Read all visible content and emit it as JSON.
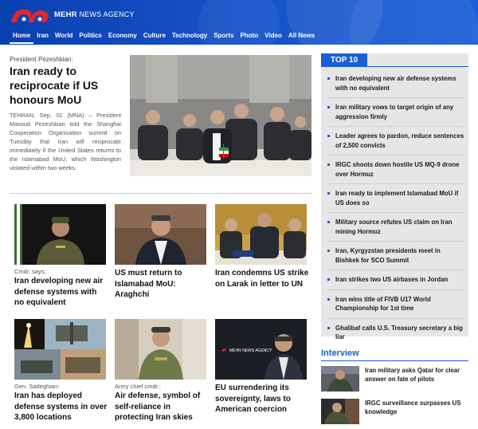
{
  "site": {
    "brand_bold": "MEHR",
    "brand_rest": " NEWS AGENCY"
  },
  "nav": [
    "Home",
    "Iran",
    "World",
    "Politics",
    "Economy",
    "Culture",
    "Technology",
    "Sports",
    "Photo",
    "Video",
    "All News"
  ],
  "lead": {
    "kicker": "President Pezeshkian:",
    "title": "Iran ready to reciprocate if US honours MoU",
    "body": "TEHRAN, Sep. 01 (MNA) – President Masoud Pezeshkian told the Shanghai Cooperation Organisation summit on Tuesday that Iran will reciprocate immediately if the United States returns to the Islamabad MoU, which Washington violated within two weeks."
  },
  "cards": [
    {
      "kicker": "Cmdr. says;",
      "title": "Iran developing new air defense systems with no equivalent"
    },
    {
      "kicker": "",
      "title": "US must return to Islamabad MoU: Araghchi"
    },
    {
      "kicker": "",
      "title": "Iran condemns US strike on Larak in letter to UN"
    },
    {
      "kicker": "Gen. Sadeghian:",
      "title": "Iran has deployed defense systems in over 3,800 locations"
    },
    {
      "kicker": "Army chief cmdr.:",
      "title": "Air defense, symbol of self-reliance in protecting Iran skies"
    },
    {
      "kicker": "",
      "title": "EU surrendering its sovereignty, laws to American coercion"
    }
  ],
  "top10": {
    "heading": "TOP 10",
    "items": [
      "Iran developing new air defense systems with no equivalent",
      "Iran military vows to target origin of any aggression firmly",
      "Leader agrees to pardon, reduce sentences of 2,500 convicts",
      "IRGC shoots down hostile US MQ-9 drone over Hormuz",
      "Iran ready to implement Islamabad MoU if US does so",
      "Military source refutes US claim on Iran mining Hormuz",
      "Iran, Kyrgyzstan presidents meet in Bishkek for SCO Summit",
      "Iran strikes two US airbases in Jordan",
      "Iran wins title of FIVB U17 World Championship for 1st time",
      "Ghalibaf calls U.S. Treasury secretary a big liar"
    ]
  },
  "interview": {
    "heading": "Interview",
    "items": [
      "Iran military asks Qatar for clear answer on fate of pilots",
      "IRGC surveillance surpasses US knowledge"
    ]
  },
  "thumb_labels": {
    "card6_logo": "MEHR NEWS AGENCY"
  },
  "colors": {
    "brand_blue": "#1b5fd6",
    "logo_red": "#e3262b",
    "panel_gray": "#e6e6e6"
  }
}
